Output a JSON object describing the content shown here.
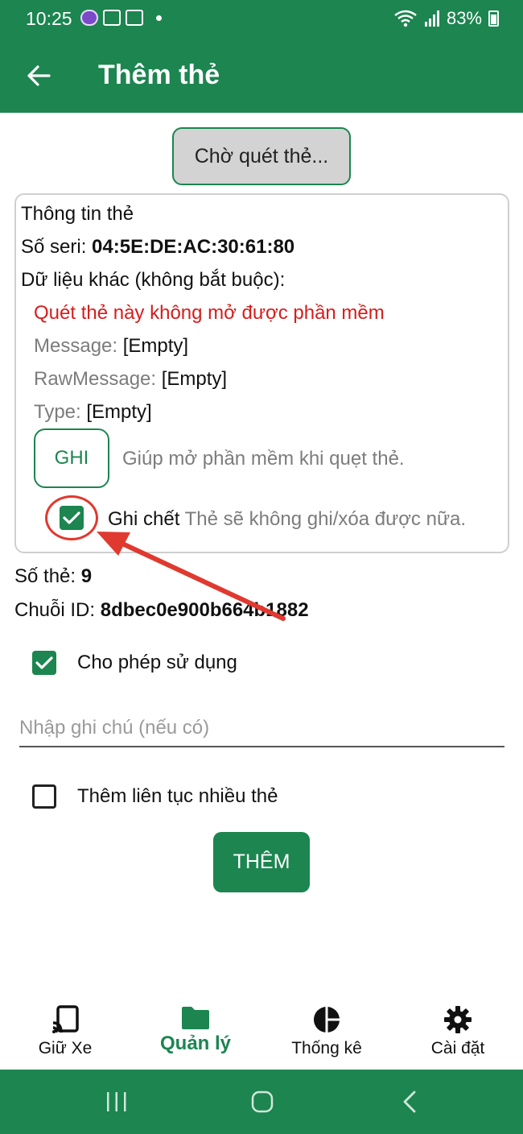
{
  "status": {
    "time": "10:25",
    "battery": "83%"
  },
  "app_bar": {
    "title": "Thêm thẻ"
  },
  "scan_button": "Chờ quét thẻ...",
  "card_info": {
    "heading": "Thông tin thẻ",
    "serial_label": "Số seri:",
    "serial_value": "04:5E:DE:AC:30:61:80",
    "other_label": "Dữ liệu khác (không bắt buộc):",
    "warning": "Quét thẻ này không mở được phần mềm",
    "message_label": "Message:",
    "message_value": "[Empty]",
    "raw_label": "RawMessage:",
    "raw_value": "[Empty]",
    "type_label": "Type:",
    "type_value": "[Empty]",
    "write_button": "GHI",
    "write_hint": "Giúp mở phần mềm khi quẹt thẻ.",
    "lock_label": "Ghi chết",
    "lock_hint": "Thẻ sẽ không ghi/xóa được nữa.",
    "lock_checked": true
  },
  "card_number_label": "Số thẻ:",
  "card_number_value": "9",
  "id_label": "Chuỗi ID:",
  "id_value": "8dbec0e900b664b1882",
  "allow_use": {
    "label": "Cho phép sử dụng",
    "checked": true
  },
  "note": {
    "placeholder": "Nhập ghi chú (nếu có)",
    "value": ""
  },
  "continuous": {
    "label": "Thêm liên tục nhiều thẻ",
    "checked": false
  },
  "add_button": "THÊM",
  "nav": {
    "items": [
      {
        "label": "Giữ Xe",
        "icon": "cast-icon",
        "active": false
      },
      {
        "label": "Quản lý",
        "icon": "folder-icon",
        "active": true
      },
      {
        "label": "Thống kê",
        "icon": "pie-chart-icon",
        "active": false
      },
      {
        "label": "Cài đặt",
        "icon": "gear-icon",
        "active": false
      }
    ]
  },
  "colors": {
    "primary": "#1c8550",
    "warning": "#d81c1c",
    "annotation": "#e0392f"
  }
}
